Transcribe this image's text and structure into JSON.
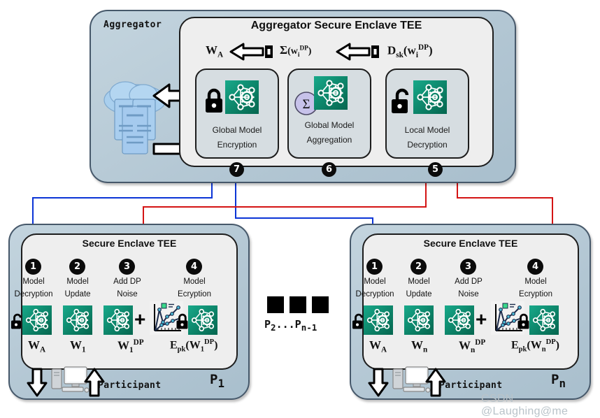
{
  "aggregator": {
    "side_label": "Aggregator",
    "enclave_title": "Aggregator Secure Enclave TEE",
    "flow_labels": {
      "left": "W_A",
      "middle": "Sum(w_i^DP)",
      "right": "D_sk(w_i^DP)"
    },
    "cards": [
      {
        "id": "global-model-encryption",
        "line1": "Global Model",
        "line2": "Encryption",
        "step": "7",
        "icon": "lock-closed-icon"
      },
      {
        "id": "global-model-aggregation",
        "line1": "Global Model",
        "line2": "Aggregation",
        "step": "6",
        "icon": "sigma-icon"
      },
      {
        "id": "local-model-decryption",
        "line1": "Local Model",
        "line2": "Decryption",
        "step": "5",
        "icon": "lock-open-icon"
      }
    ],
    "cloud_icon": "cloud-servers-icon"
  },
  "participants": [
    {
      "id": "p1",
      "panel_label": "P1",
      "enclave_title": "Secure Enclave TEE",
      "participant_word": "Participant",
      "steps": [
        {
          "num": "1",
          "line1": "Model",
          "line2": "Decryption",
          "formula": "W_A",
          "icon": "lock-open-icon"
        },
        {
          "num": "2",
          "line1": "Model",
          "line2": "Update",
          "formula": "W_1",
          "icon": "nn-icon"
        },
        {
          "num": "3",
          "line1": "Add DP",
          "line2": "Noise",
          "formula": "W_1^DP",
          "icon": "noise-chart-icon"
        },
        {
          "num": "4",
          "line1": "Model",
          "line2": "Ecryption",
          "formula": "E_pk(W_1^DP)",
          "icon": "lock-closed-icon"
        }
      ]
    },
    {
      "id": "pn",
      "panel_label": "Pn",
      "enclave_title": "Secure Enclave TEE",
      "participant_word": "Participant",
      "steps": [
        {
          "num": "1",
          "line1": "Model",
          "line2": "Decryption",
          "formula": "W_A",
          "icon": "lock-open-icon"
        },
        {
          "num": "2",
          "line1": "Model",
          "line2": "Update",
          "formula": "W_n",
          "icon": "nn-icon"
        },
        {
          "num": "3",
          "line1": "Add DP",
          "line2": "Noise",
          "formula": "W_n^DP",
          "icon": "noise-chart-icon"
        },
        {
          "num": "4",
          "line1": "Model",
          "line2": "Ecryption",
          "formula": "E_pk(W_n^DP)",
          "icon": "lock-closed-icon"
        }
      ]
    }
  ],
  "middle": {
    "ellipsis_label": "P2...Pn-1",
    "square_count": 3
  },
  "watermark": "CSDN @Laughing@me",
  "colors": {
    "panel_fill": "#b7cad6",
    "panel_stroke": "#46586a",
    "enclave_fill": "#eeeeee",
    "enclave_stroke": "#1d1d1d",
    "card_fill": "#d6dde1",
    "nn_green_light": "#18a98a",
    "nn_green_dark": "#06664f",
    "sigma_fill": "#c7c2ea",
    "downlink_blue": "#0b35d6",
    "uplink_red": "#d41414",
    "cloud_blue": "#a8cdee"
  }
}
